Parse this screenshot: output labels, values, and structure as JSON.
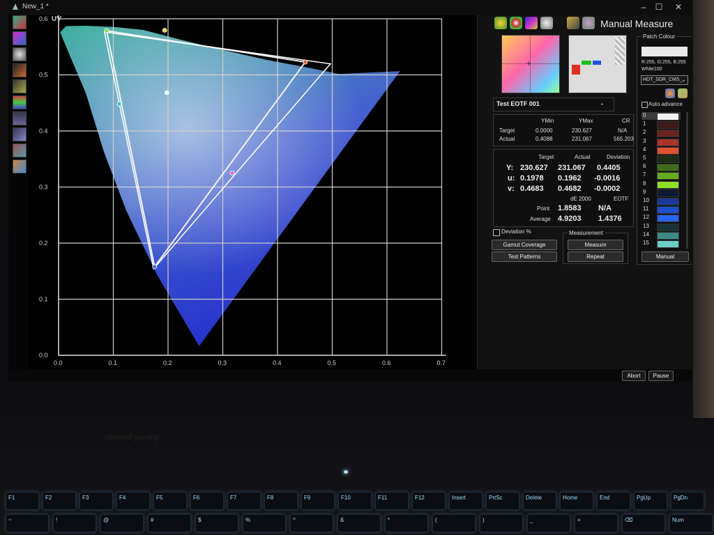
{
  "window": {
    "title": "New_1 *",
    "controls": [
      "–",
      "☐",
      "✕"
    ]
  },
  "plot": {
    "y_axis_title": "UV",
    "x_ticks": [
      "0.0",
      "0.1",
      "0.2",
      "0.3",
      "0.4",
      "0.5",
      "0.6",
      "0.7"
    ],
    "y_ticks": [
      "0.0",
      "0.1",
      "0.2",
      "0.3",
      "0.4",
      "0.5",
      "0.6"
    ],
    "gamut_target": [
      [
        0.0878,
        0.5788
      ],
      [
        0.4507,
        0.5229
      ],
      [
        0.1754,
        0.1579
      ]
    ],
    "gamut_measured": [
      [
        0.0838,
        0.5766
      ],
      [
        0.4968,
        0.5197
      ],
      [
        0.1737,
        0.1544
      ]
    ],
    "whitepoint": [
      0.1978,
      0.4683
    ],
    "grid": true
  },
  "panel": {
    "title": "Manual Measure",
    "toolbar_icons": [
      "chromaticity-icon",
      "rgb-wheel-icon",
      "spectrum-icon",
      "sphere-icon",
      "swap-icon",
      "gamut-icon"
    ],
    "patch_colour_label": "Patch Colour",
    "patch_rgb": "R:255, G:255, B:255",
    "patch_name": "White100",
    "profile_select": "HDT_SDR_CMS_",
    "auto_advance_label": "Auto advance",
    "test_name": "Test EOTF 001",
    "test_dash": "-",
    "lum_headers": [
      "YMin",
      "YMax",
      "CR"
    ],
    "lum_rows": [
      {
        "label": "Target",
        "ymin": "0.0000",
        "ymax": "230.627",
        "cr": "N/A"
      },
      {
        "label": "Actual",
        "ymin": "0.4088",
        "ymax": "231.067",
        "cr": "565.203"
      }
    ],
    "meas_headers": [
      "Target",
      "Actual",
      "Deviation"
    ],
    "meas_rows": [
      {
        "label": "Y:",
        "target": "230.627",
        "actual": "231.067",
        "dev": "0.4405"
      },
      {
        "label": "u:",
        "target": "0.1978",
        "actual": "0.1962",
        "dev": "-0.0016"
      },
      {
        "label": "v:",
        "target": "0.4683",
        "actual": "0.4682",
        "dev": "-0.0002"
      }
    ],
    "de_headers": [
      "dE 2000",
      "EOTF"
    ],
    "de_rows": [
      {
        "label": "Point",
        "de": "1.8583",
        "eotf": "N/A"
      },
      {
        "label": "Average",
        "de": "4.9203",
        "eotf": "1.4376"
      }
    ],
    "deviation_pct_label": "Deviation %",
    "measurement_label": "Measurement",
    "buttons": {
      "gamut": "Gamut Coverage",
      "test_patterns": "Test Patterns",
      "measure": "Measure",
      "repeat": "Repeat",
      "manual": "Manual"
    },
    "patches": [
      {
        "n": "0",
        "color": "#f2f2f2"
      },
      {
        "n": "1",
        "color": "#3a1a18"
      },
      {
        "n": "2",
        "color": "#6a2420"
      },
      {
        "n": "3",
        "color": "#a83428"
      },
      {
        "n": "4",
        "color": "#e05232"
      },
      {
        "n": "5",
        "color": "#1c2c14"
      },
      {
        "n": "6",
        "color": "#3e6a1a"
      },
      {
        "n": "7",
        "color": "#66aa20"
      },
      {
        "n": "8",
        "color": "#8ede2a"
      },
      {
        "n": "9",
        "color": "#0e1830"
      },
      {
        "n": "10",
        "color": "#1c3a9a"
      },
      {
        "n": "11",
        "color": "#1e4ecc"
      },
      {
        "n": "12",
        "color": "#2a64f0"
      },
      {
        "n": "13",
        "color": "#163436"
      },
      {
        "n": "14",
        "color": "#3a8a88"
      },
      {
        "n": "15",
        "color": "#6ad0c8"
      }
    ]
  },
  "bottom": {
    "abort": "Abort",
    "pause": "Pause"
  },
  "brand": "ideapad gaming",
  "keyboard": {
    "fn_row": [
      "F1",
      "F2",
      "F3",
      "F4",
      "F5",
      "F6",
      "F7",
      "F8",
      "F9",
      "F10",
      "F11",
      "F12",
      "Insert",
      "PrtSc",
      "Delete",
      "Home",
      "End",
      "PgUp",
      "PgDn"
    ],
    "num_row": [
      "~",
      "!",
      "@",
      "#",
      "$",
      "%",
      "^",
      "&",
      "*",
      "(",
      ")",
      "_",
      "+",
      "⌫",
      "Num"
    ]
  }
}
